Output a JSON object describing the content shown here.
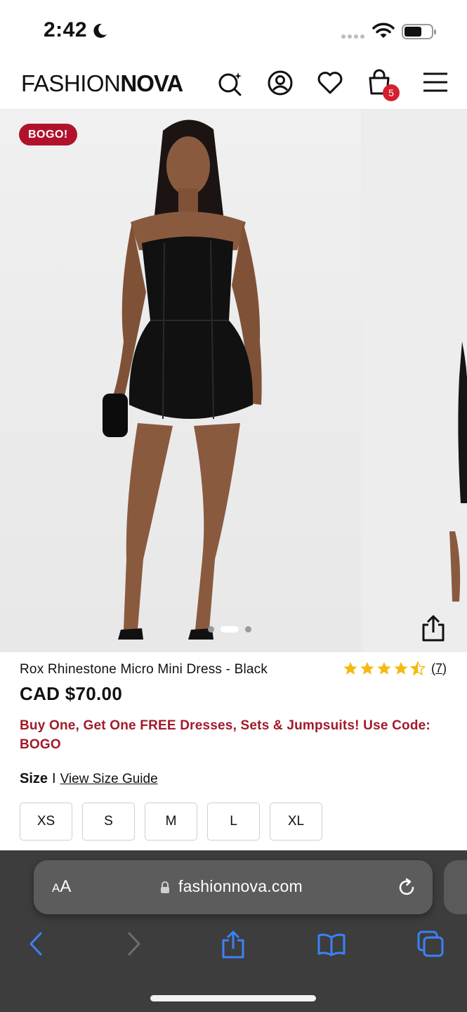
{
  "status_bar": {
    "time": "2:42"
  },
  "header": {
    "logo_thin": "FASHION",
    "logo_bold": "NOVA",
    "cart_count": "5",
    "icons": [
      "ai-search-icon",
      "account-icon",
      "heart-icon",
      "shopping-bag-icon",
      "hamburger-menu-icon"
    ]
  },
  "gallery": {
    "badge": "BOGO!",
    "slide_count": 3,
    "active_slide": 2
  },
  "product": {
    "title": "Rox Rhinestone Micro Mini Dress - Black",
    "price": "CAD $70.00",
    "rating": 4.5,
    "review_count": "(7)",
    "promo": "Buy One, Get One FREE Dresses, Sets & Jumpsuits! Use Code: BOGO",
    "size_label": "Size",
    "size_separator": "I",
    "size_guide": "View Size Guide",
    "sizes": [
      "XS",
      "S",
      "M",
      "L",
      "XL"
    ]
  },
  "browser": {
    "text_size_big": "A",
    "text_size_small": "A",
    "url": "fashionnova.com"
  },
  "colors": {
    "badge": "#b0122c",
    "promo": "#a21a2a",
    "cart_badge": "#d61f2c",
    "star": "#f5b90f",
    "safari_blue": "#3b82f6"
  }
}
